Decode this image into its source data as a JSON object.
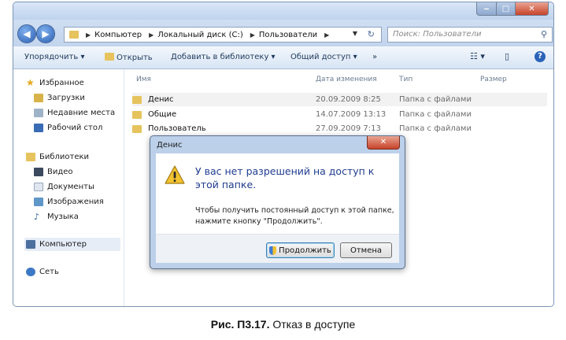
{
  "window": {
    "buttons": {
      "minimize": "‒",
      "maximize": "□",
      "close": "✕"
    }
  },
  "address": {
    "crumbs": [
      "Компьютер",
      "Локальный диск (C:)",
      "Пользователи"
    ],
    "search_placeholder": "Поиск: Пользователи"
  },
  "toolbar": {
    "organize": "Упорядочить ▾",
    "open": "Открыть",
    "add_library": "Добавить в библиотеку ▾",
    "share": "Общий доступ ▾",
    "more": "»"
  },
  "nav": {
    "favorites": {
      "label": "Избранное",
      "items": [
        "Загрузки",
        "Недавние места",
        "Рабочий стол"
      ]
    },
    "libraries": {
      "label": "Библиотеки",
      "items": [
        "Видео",
        "Документы",
        "Изображения",
        "Музыка"
      ]
    },
    "computer": "Компьютер",
    "network": "Сеть"
  },
  "list": {
    "columns": {
      "name": "Имя",
      "date": "Дата изменения",
      "type": "Тип",
      "size": "Размер"
    },
    "rows": [
      {
        "name": "Денис",
        "date": "20.09.2009 8:25",
        "type": "Папка с файлами"
      },
      {
        "name": "Общие",
        "date": "14.07.2009 13:13",
        "type": "Папка с файлами"
      },
      {
        "name": "Пользователь",
        "date": "27.09.2009 7:13",
        "type": "Папка с файлами"
      }
    ]
  },
  "dialog": {
    "title": "Денис",
    "close": "✕",
    "message": "У вас нет разрешений на доступ к этой папке.",
    "detail": "Чтобы получить постоянный доступ к этой папке, нажмите кнопку \"Продолжить\".",
    "continue_label": "Продолжить",
    "cancel_label": "Отмена"
  },
  "caption": {
    "label": "Рис. П3.17.",
    "text": "Отказ в доступе"
  },
  "colors": {
    "dialog_text": "#1f3c8f",
    "folder": "#e6c35c",
    "close_button": "#c7432a"
  }
}
